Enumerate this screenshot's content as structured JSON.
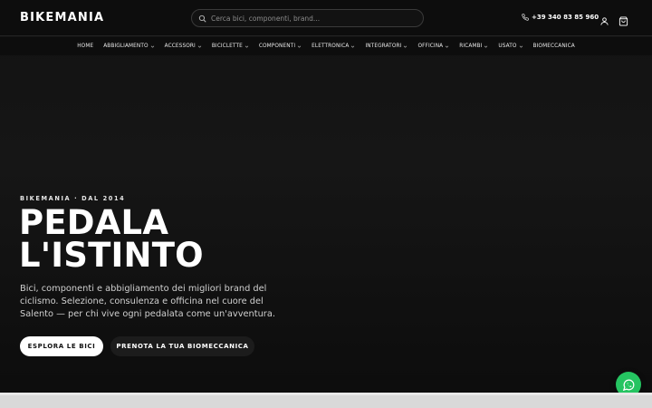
{
  "header": {
    "logo": "BIKEMANIA",
    "search_placeholder": "Cerca bici, componenti, brand...",
    "phone": "+39 340 83 85 960"
  },
  "nav": [
    {
      "label": "HOME",
      "dropdown": false
    },
    {
      "label": "ABBIGLIAMENTO",
      "dropdown": true
    },
    {
      "label": "ACCESSORI",
      "dropdown": true
    },
    {
      "label": "BICICLETTE",
      "dropdown": true
    },
    {
      "label": "COMPONENTI",
      "dropdown": true
    },
    {
      "label": "ELETTRONICA",
      "dropdown": true
    },
    {
      "label": "INTEGRATORI",
      "dropdown": true
    },
    {
      "label": "OFFICINA",
      "dropdown": true
    },
    {
      "label": "RICAMBI",
      "dropdown": true
    },
    {
      "label": "USATO",
      "dropdown": true
    },
    {
      "label": "BIOMECCANICA",
      "dropdown": false
    }
  ],
  "hero": {
    "eyebrow": "BIKEMANIA · DAL 2014",
    "headline_line1": "PEDALA",
    "headline_line2": "L'ISTINTO",
    "description": "Bici, componenti e abbigliamento dei migliori brand del ciclismo. Selezione, consulenza e officina nel cuore del Salento — per chi vive ogni pedalata come un'avventura.",
    "cta_primary": "ESPLORA LE BICI",
    "cta_secondary": "PRENOTA LA TUA BIOMECCANICA"
  },
  "colors": {
    "background": "#0a0a0a",
    "whatsapp": "#25c461",
    "primary_button": "#ffffff"
  },
  "icons": {
    "search": "search-icon",
    "phone": "phone-icon",
    "account": "user-icon",
    "cart": "shopping-bag-icon",
    "chat": "whatsapp-icon"
  }
}
